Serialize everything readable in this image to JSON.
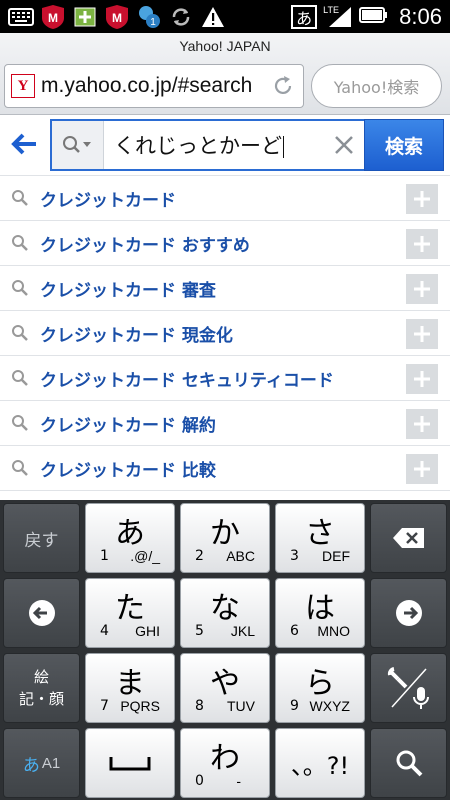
{
  "status_bar": {
    "time": "8:06",
    "ime_indicator": "あ",
    "network": "LTE",
    "icons": [
      "keyboard-icon",
      "mcafee-icon",
      "add-icon",
      "mcafee-icon",
      "notification-icon",
      "sync-icon",
      "warning-icon"
    ]
  },
  "browser": {
    "page_title": "Yahoo! JAPAN",
    "url": "m.yahoo.co.jp/#search",
    "yahoo_icon_letter": "Y",
    "search_placeholder": "Yahoo!検索"
  },
  "search": {
    "query": "くれじっとかーど",
    "button_label": "検索"
  },
  "suggestions": [
    "クレジットカード",
    "クレジットカード おすすめ",
    "クレジットカード 審査",
    "クレジットカード 現金化",
    "クレジットカード セキュリティコード",
    "クレジットカード 解約",
    "クレジットカード 比較"
  ],
  "keyboard": {
    "undo": "戻す",
    "symbols_line1": "絵",
    "symbols_line2": "記・顔",
    "mode_a": "あ",
    "mode_b": "A1",
    "keys": [
      {
        "main": "あ",
        "num": "1",
        "alpha": ".@/_"
      },
      {
        "main": "か",
        "num": "2",
        "alpha": "ABC"
      },
      {
        "main": "さ",
        "num": "3",
        "alpha": "DEF"
      },
      {
        "main": "た",
        "num": "4",
        "alpha": "GHI"
      },
      {
        "main": "な",
        "num": "5",
        "alpha": "JKL"
      },
      {
        "main": "は",
        "num": "6",
        "alpha": "MNO"
      },
      {
        "main": "ま",
        "num": "7",
        "alpha": "PQRS"
      },
      {
        "main": "や",
        "num": "8",
        "alpha": "TUV"
      },
      {
        "main": "ら",
        "num": "9",
        "alpha": "WXYZ"
      },
      {
        "main": "わ",
        "num": "0",
        "alpha": "-"
      }
    ],
    "punct": "、。?!"
  }
}
